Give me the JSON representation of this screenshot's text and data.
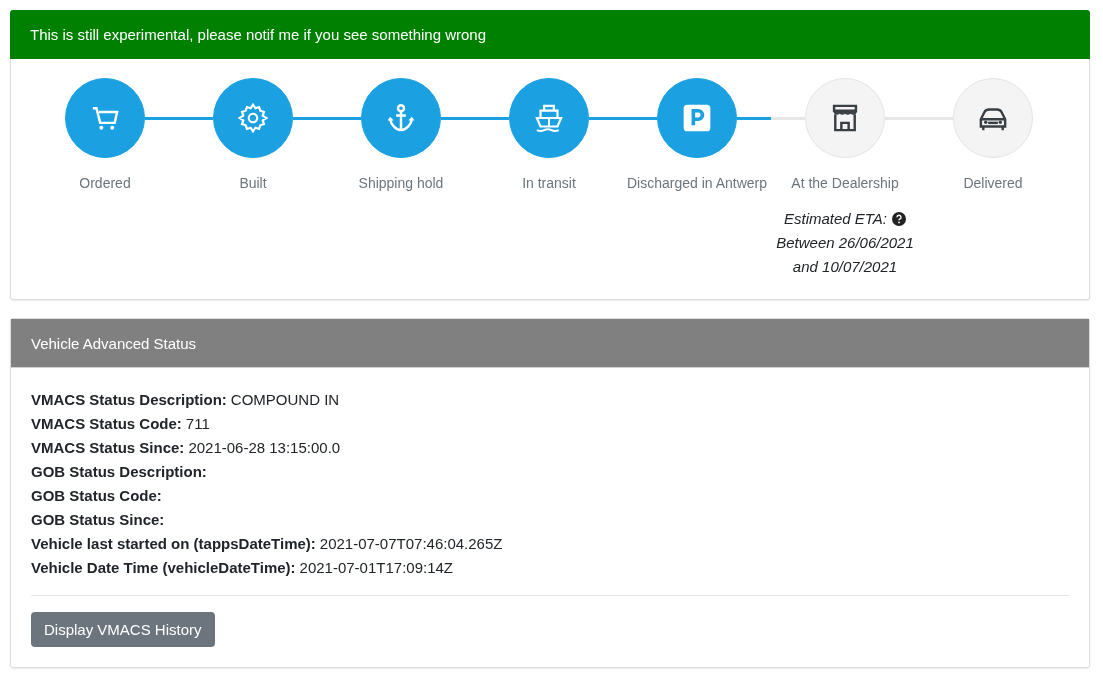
{
  "alert": {
    "text": "This is still experimental, please notif me if you see something wrong"
  },
  "steps": [
    {
      "label": "Ordered",
      "done": true
    },
    {
      "label": "Built",
      "done": true
    },
    {
      "label": "Shipping hold",
      "done": true
    },
    {
      "label": "In transit",
      "done": true
    },
    {
      "label": "Discharged in Antwerp",
      "done": true
    },
    {
      "label": "At the Dealership",
      "done": false,
      "note": {
        "title": "Estimated ETA:",
        "lines": [
          "Between 26/06/2021",
          "and 10/07/2021"
        ]
      }
    },
    {
      "label": "Delivered",
      "done": false
    }
  ],
  "status_panel": {
    "title": "Vehicle Advanced Status",
    "fields": [
      {
        "label": "VMACS Status Description:",
        "value": "COMPOUND IN"
      },
      {
        "label": "VMACS Status Code:",
        "value": "711"
      },
      {
        "label": "VMACS Status Since:",
        "value": "2021-06-28 13:15:00.0"
      },
      {
        "label": "GOB Status Description:"
      },
      {
        "label": "GOB Status Code:"
      },
      {
        "label": "GOB Status Since:"
      },
      {
        "label": "Vehicle last started on (tappsDateTime):",
        "value": "2021-07-07T07:46:04.265Z"
      },
      {
        "label": "Vehicle Date Time (vehicleDateTime):",
        "value": "2021-07-01T17:09:14Z"
      }
    ],
    "button": "Display VMACS History"
  }
}
